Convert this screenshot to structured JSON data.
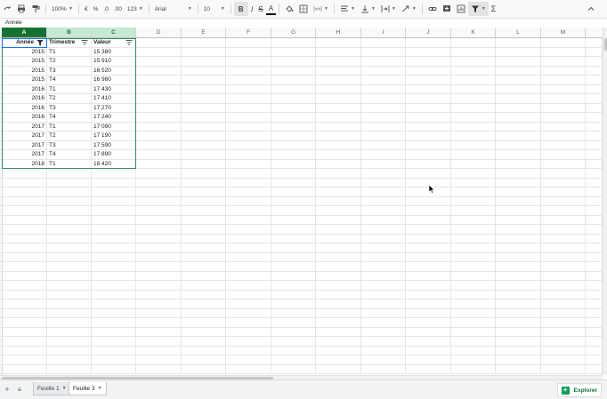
{
  "toolbar": {
    "zoom": "100%",
    "currency": "€",
    "percent": "%",
    "decrease_decimals": ".0",
    "increase_decimals": ".00",
    "more_formats": "123",
    "font": "Arial",
    "font_size": "10",
    "bold": "B",
    "italic": "I",
    "strike": "S",
    "text_color": "A",
    "sum": "Σ"
  },
  "formula_bar": {
    "content": "Année"
  },
  "columns": [
    "A",
    "B",
    "C",
    "D",
    "E",
    "F",
    "G",
    "H",
    "I",
    "J",
    "K",
    "L",
    "M"
  ],
  "header_row": {
    "a": "Année",
    "b": "Trimestre",
    "c": "Valeur"
  },
  "rows": [
    {
      "year": "2015",
      "quarter": "T1",
      "value": "15 380"
    },
    {
      "year": "2015",
      "quarter": "T2",
      "value": "15 910"
    },
    {
      "year": "2015",
      "quarter": "T3",
      "value": "16 520"
    },
    {
      "year": "2015",
      "quarter": "T4",
      "value": "16 980"
    },
    {
      "year": "2016",
      "quarter": "T1",
      "value": "17 430"
    },
    {
      "year": "2016",
      "quarter": "T2",
      "value": "17 410"
    },
    {
      "year": "2016",
      "quarter": "T3",
      "value": "17 270"
    },
    {
      "year": "2016",
      "quarter": "T4",
      "value": "17 240"
    },
    {
      "year": "2017",
      "quarter": "T1",
      "value": "17 090"
    },
    {
      "year": "2017",
      "quarter": "T2",
      "value": "17 190"
    },
    {
      "year": "2017",
      "quarter": "T3",
      "value": "17 590"
    },
    {
      "year": "2017",
      "quarter": "T4",
      "value": "17 890"
    },
    {
      "year": "2018",
      "quarter": "T1",
      "value": "18 420"
    }
  ],
  "sheets": [
    {
      "name": "Feuille 1",
      "active": false
    },
    {
      "name": "Feuille 3",
      "active": true
    }
  ],
  "explore_label": "Explorer",
  "colors": {
    "accent_green": "#137333",
    "selection_green": "#c6e9d4",
    "active_blue": "#1a73e8"
  }
}
